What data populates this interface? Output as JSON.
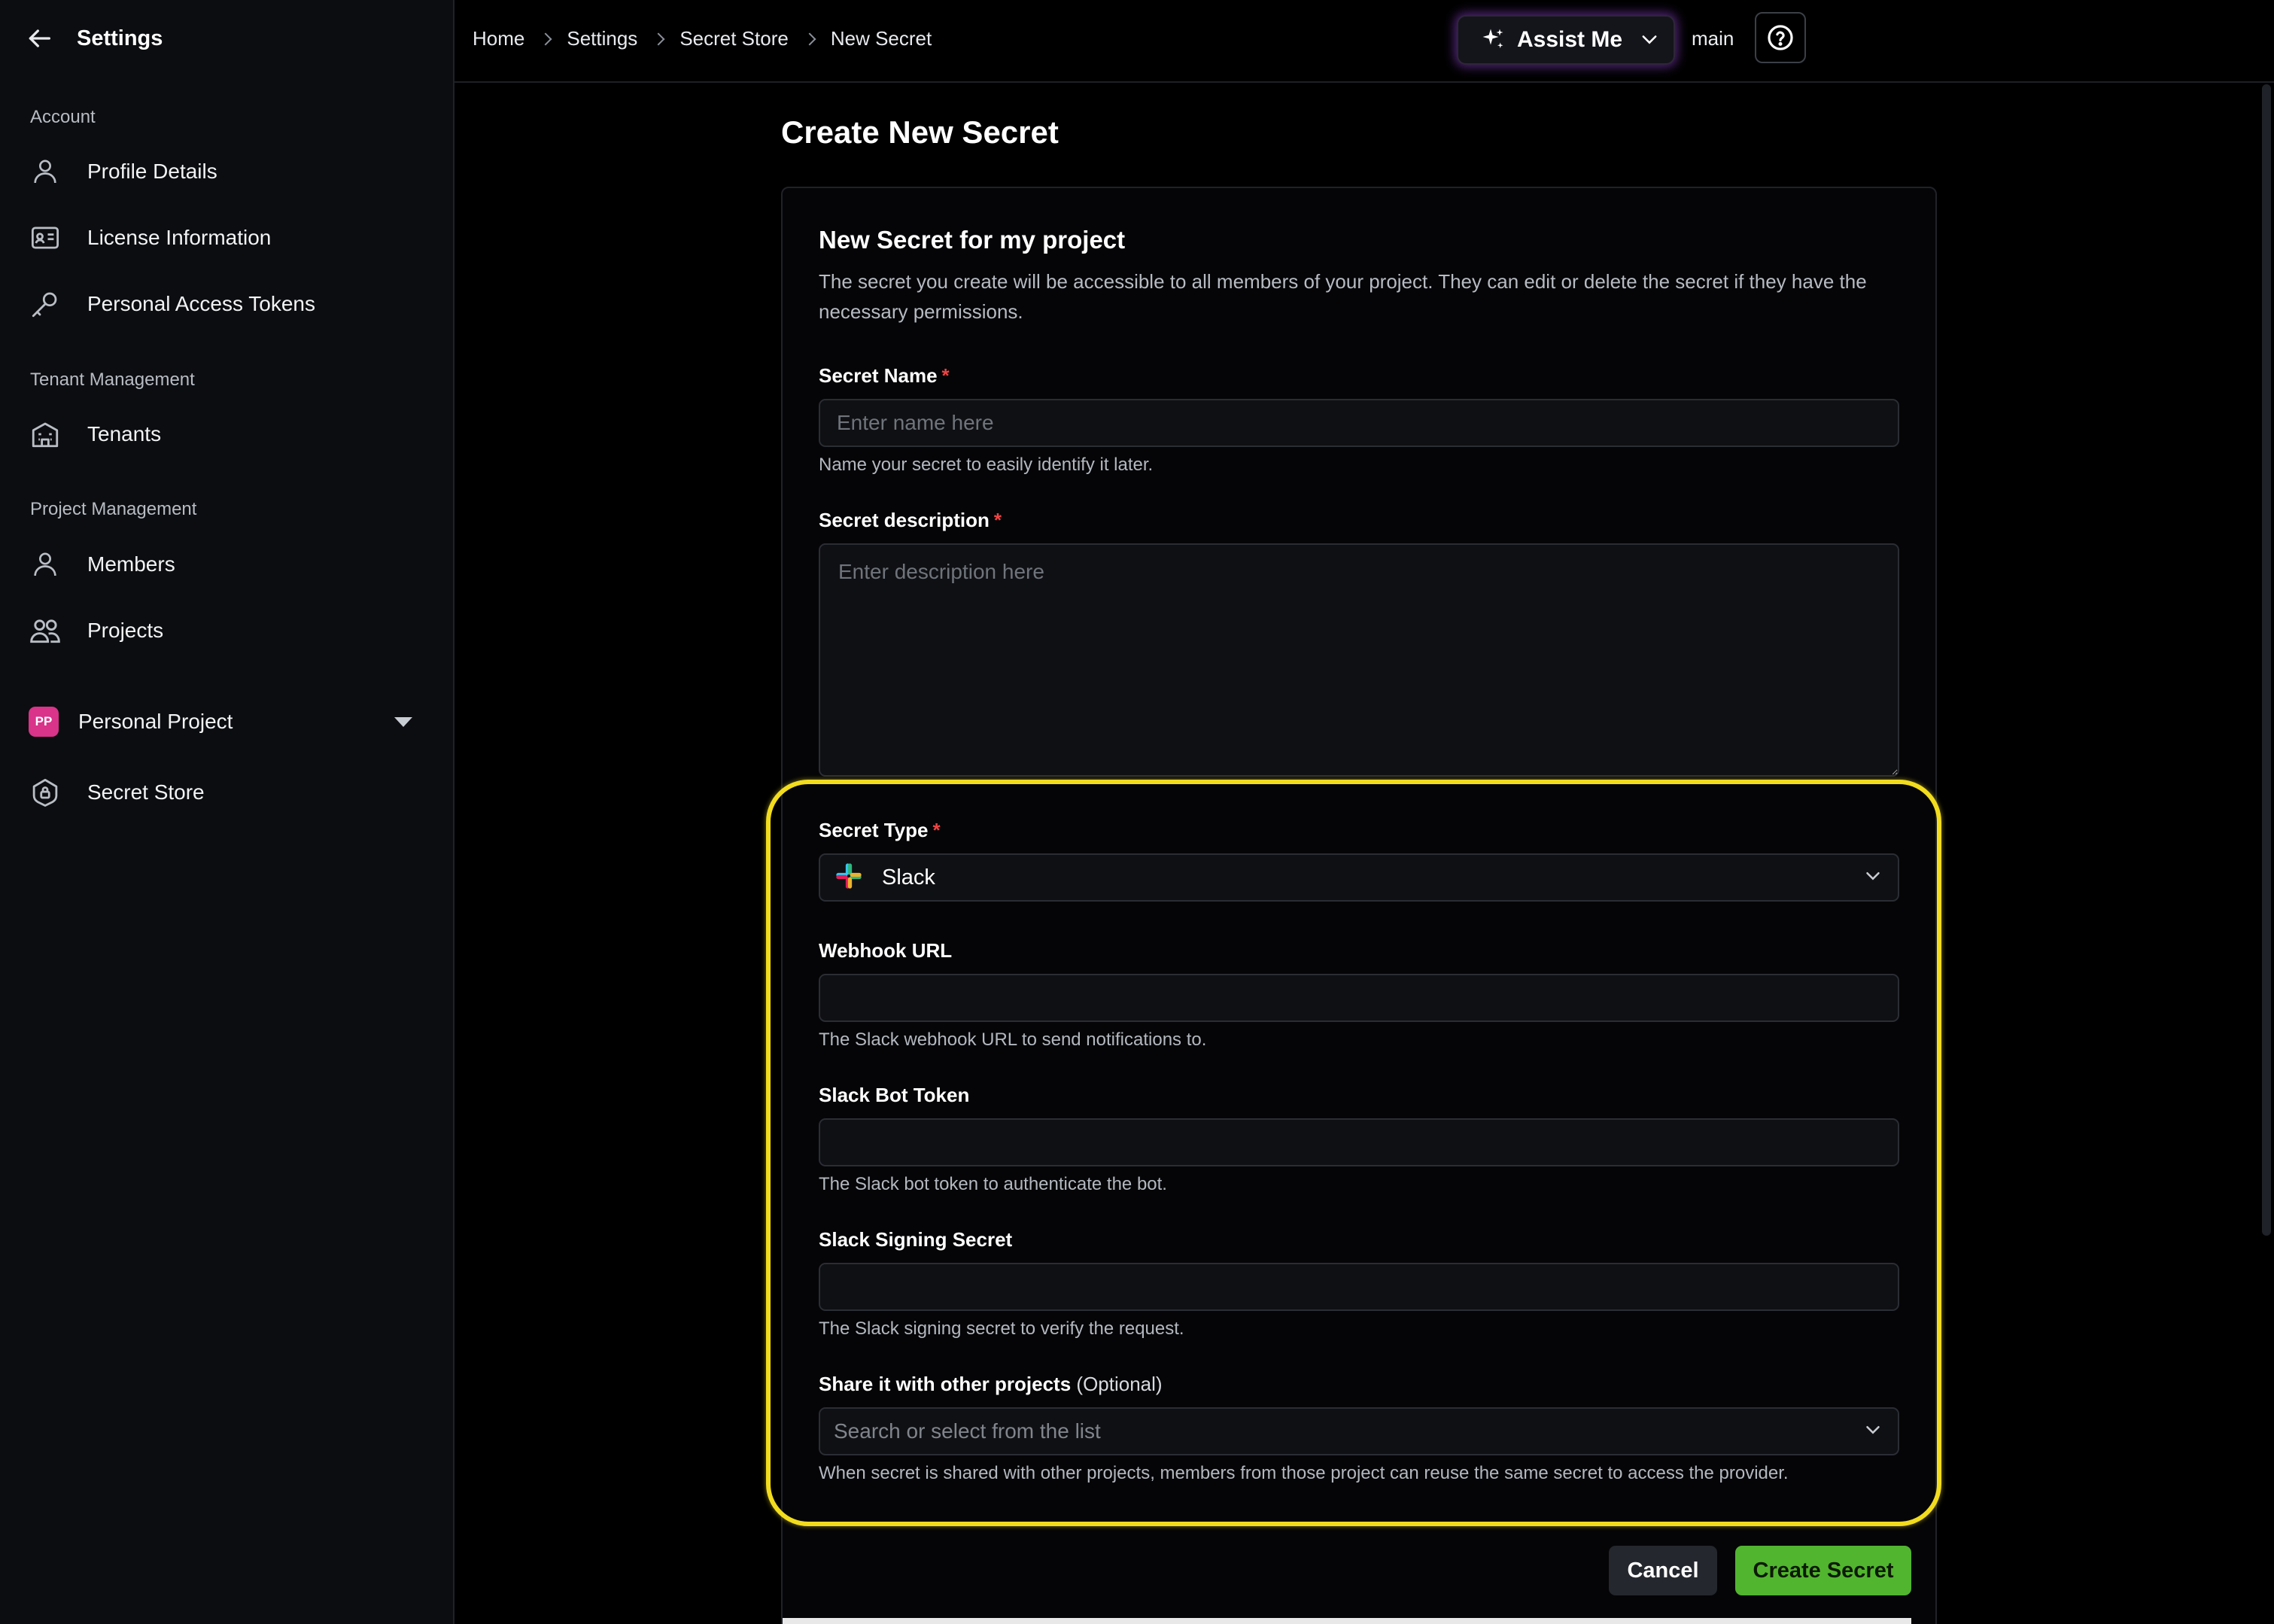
{
  "sidebar": {
    "title": "Settings",
    "sections": {
      "account": "Account",
      "tenant": "Tenant Management",
      "project": "Project Management"
    },
    "items": {
      "profile": "Profile Details",
      "license": "License Information",
      "tokens": "Personal Access Tokens",
      "tenants": "Tenants",
      "members": "Members",
      "projects": "Projects",
      "secret_store": "Secret Store"
    },
    "project_switcher": {
      "badge": "PP",
      "label": "Personal Project",
      "badge_color": "#d9338a"
    }
  },
  "topbar": {
    "breadcrumbs": [
      "Home",
      "Settings",
      "Secret Store",
      "New Secret"
    ],
    "assist_label": "Assist Me",
    "branch": "main"
  },
  "main": {
    "page_title": "Create New Secret",
    "card_title": "New Secret for my project",
    "card_description": "The secret you create will be accessible to all members of your project. They can edit or delete the secret if they have the necessary permissions.",
    "fields": {
      "name": {
        "label": "Secret Name",
        "required": "*",
        "placeholder": "Enter name here",
        "value": "",
        "hint": "Name your secret to easily identify it later."
      },
      "description": {
        "label": "Secret description",
        "required": "*",
        "placeholder": "Enter description here",
        "value": ""
      },
      "type": {
        "label": "Secret Type",
        "required": "*",
        "selected": "Slack",
        "icon": "slack-logo-icon"
      },
      "webhook": {
        "label": "Webhook URL",
        "value": "",
        "hint": "The Slack webhook URL to send notifications to."
      },
      "bot_token": {
        "label": "Slack Bot Token",
        "value": "",
        "hint": "The Slack bot token to authenticate the bot."
      },
      "signing_secret": {
        "label": "Slack Signing Secret",
        "value": "",
        "hint": "The Slack signing secret to verify the request."
      },
      "share": {
        "label": "Share it with other projects",
        "optional": "(Optional)",
        "placeholder": "Search or select from the list",
        "hint": "When secret is shared with other projects, members from those project can reuse the same secret to access the provider."
      }
    },
    "actions": {
      "cancel": "Cancel",
      "create": "Create Secret"
    }
  },
  "colors": {
    "accent_green": "#52b52f",
    "highlight_yellow": "#f2dc1e",
    "required_red": "#ef4444",
    "assist_glow": "#9646dc"
  }
}
